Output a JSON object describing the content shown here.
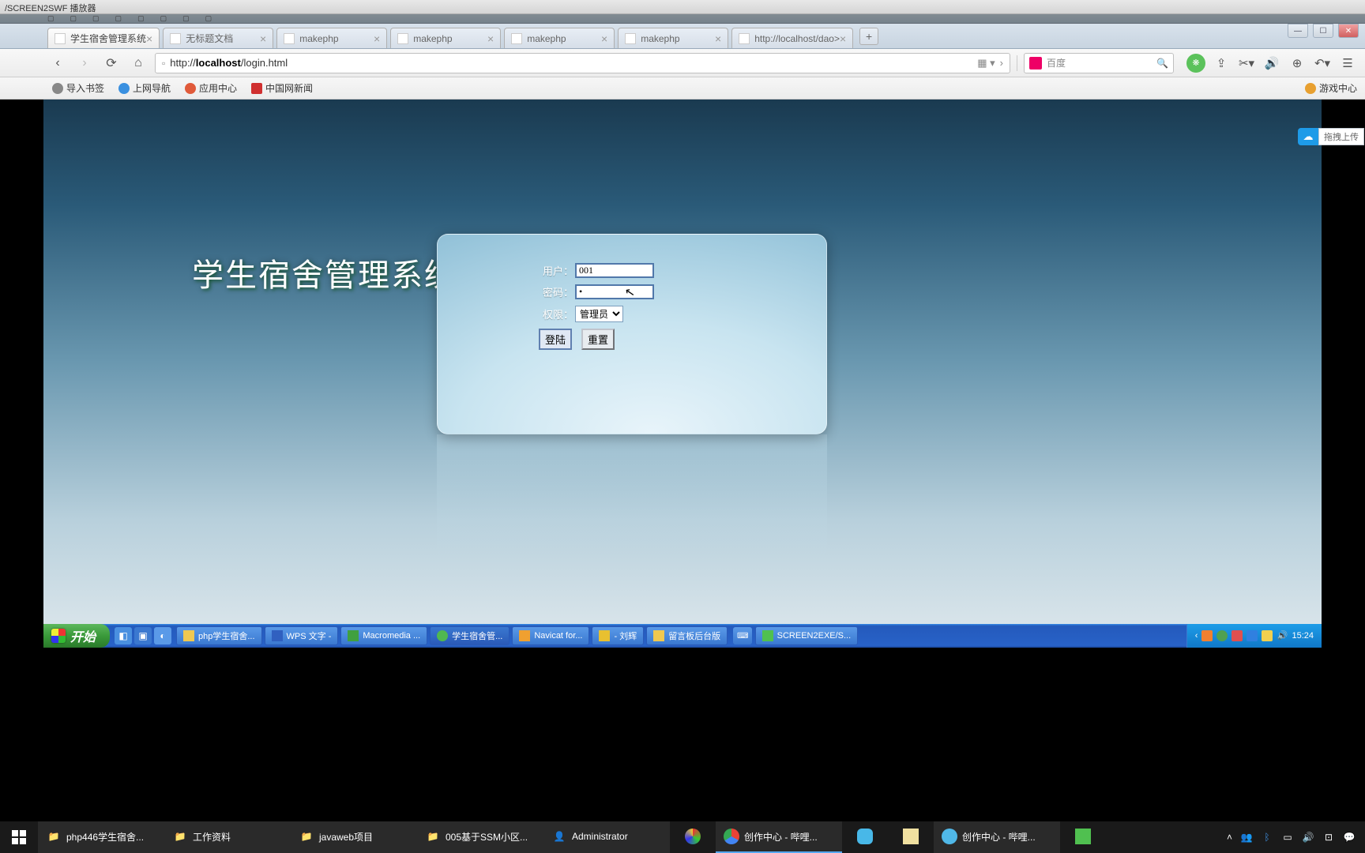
{
  "player_title": "/SCREEN2SWF 播放器",
  "tabs": [
    {
      "label": "学生宿舍管理系统",
      "active": true
    },
    {
      "label": "无标题文档",
      "active": false
    },
    {
      "label": "makephp",
      "active": false
    },
    {
      "label": "makephp",
      "active": false
    },
    {
      "label": "makephp",
      "active": false
    },
    {
      "label": "makephp",
      "active": false
    },
    {
      "label": "http://localhost/dao>",
      "active": false
    }
  ],
  "url": {
    "prefix": "http://",
    "host": "localhost",
    "path": "/login.html"
  },
  "search_placeholder": "百度",
  "bookmarks": {
    "import": "导入书签",
    "nav": "上网导航",
    "appcenter": "应用中心",
    "news": "中国网新闻",
    "gamecenter": "游戏中心"
  },
  "upload_label": "拖拽上传",
  "page": {
    "title": "学生宿舍管理系统",
    "labels": {
      "user": "用户：",
      "password": "密码：",
      "role": "权限："
    },
    "values": {
      "user": "001",
      "password": "•",
      "role": "管理员"
    },
    "buttons": {
      "login": "登陆",
      "reset": "重置"
    }
  },
  "xp": {
    "start": "开始",
    "tasks": [
      "php学生宿舍...",
      "WPS 文字 - ",
      "Macromedia ...",
      "学生宿舍管...",
      "Navicat for...",
      " - 刘辉",
      "留言板后台版",
      "SCREEN2EXE/S..."
    ],
    "time": "15:24"
  },
  "w10": {
    "tasks": [
      "php446学生宿舍...",
      "工作资料",
      "javaweb项目",
      "005基于SSM小区...",
      "Administrator",
      "",
      "创作中心 - 哔哩...",
      "",
      "",
      "创作中心 - 哔哩...",
      ""
    ]
  }
}
